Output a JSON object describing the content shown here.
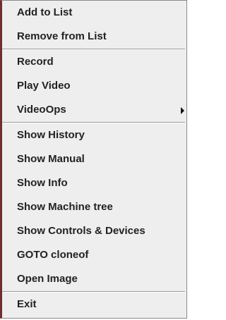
{
  "menu": {
    "items": [
      {
        "label": "Add to List"
      },
      {
        "label": "Remove from List"
      },
      {
        "label": "Record"
      },
      {
        "label": "Play Video"
      },
      {
        "label": "VideoOps",
        "submenu_icon": "chevron-right-icon"
      },
      {
        "label": "Show History"
      },
      {
        "label": "Show Manual"
      },
      {
        "label": "Show Info"
      },
      {
        "label": "Show Machine tree"
      },
      {
        "label": "Show Controls & Devices"
      },
      {
        "label": "GOTO cloneof"
      },
      {
        "label": "Open Image"
      },
      {
        "label": "Exit"
      }
    ]
  },
  "colors": {
    "background": "#eeeeee",
    "text": "#222222",
    "left_accent": "#6f2f2f",
    "separator": "#9a9a9a"
  }
}
